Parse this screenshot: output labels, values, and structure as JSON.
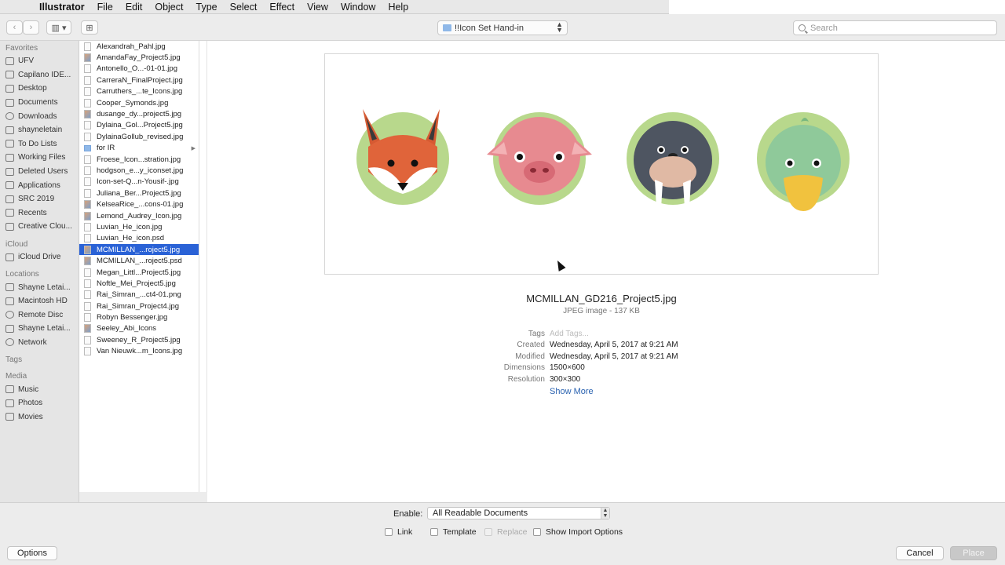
{
  "menubar": {
    "app": "Illustrator",
    "items": [
      "File",
      "Edit",
      "Object",
      "Type",
      "Select",
      "Effect",
      "View",
      "Window",
      "Help"
    ]
  },
  "toolbar": {
    "path": "!!Icon Set Hand-in",
    "search_placeholder": "Search"
  },
  "sidebar": {
    "favorites_title": "Favorites",
    "favorites": [
      "UFV",
      "Capilano IDE...",
      "Desktop",
      "Documents",
      "Downloads",
      "shayneletain",
      "To Do Lists",
      "Working Files",
      "Deleted Users",
      "Applications",
      "SRC 2019",
      "Recents",
      "Creative Clou..."
    ],
    "icloud_title": "iCloud",
    "icloud": [
      "iCloud Drive"
    ],
    "locations_title": "Locations",
    "locations": [
      "Shayne Letai...",
      "Macintosh HD",
      "Remote Disc",
      "Shayne Letai...",
      "Network"
    ],
    "tags_title": "Tags",
    "media_title": "Media",
    "media": [
      "Music",
      "Photos",
      "Movies"
    ]
  },
  "files": [
    {
      "name": "Alexandrah_Pahl.jpg",
      "kind": "doc"
    },
    {
      "name": "AmandaFay_Project5.jpg",
      "kind": "img"
    },
    {
      "name": "Antonello_O...-01-01.jpg",
      "kind": "doc"
    },
    {
      "name": "CarreraN_FinalProject.jpg",
      "kind": "doc"
    },
    {
      "name": "Carruthers_...te_Icons.jpg",
      "kind": "doc"
    },
    {
      "name": "Cooper_Symonds.jpg",
      "kind": "doc"
    },
    {
      "name": "dusange_dy...project5.jpg",
      "kind": "img"
    },
    {
      "name": "Dylaina_Gol...Project5.jpg",
      "kind": "doc"
    },
    {
      "name": "DylainaGollub_revised.jpg",
      "kind": "doc"
    },
    {
      "name": "for IR",
      "kind": "folder"
    },
    {
      "name": "Froese_Icon...stration.jpg",
      "kind": "doc"
    },
    {
      "name": "hodgson_e...y_iconset.jpg",
      "kind": "doc"
    },
    {
      "name": "Icon-set-Q...n-Yousif-.jpg",
      "kind": "doc"
    },
    {
      "name": "Juliana_Ber...Project5.jpg",
      "kind": "doc"
    },
    {
      "name": "KelseaRice_...cons-01.jpg",
      "kind": "img"
    },
    {
      "name": "Lemond_Audrey_Icon.jpg",
      "kind": "img"
    },
    {
      "name": "Luvian_He_icon.jpg",
      "kind": "doc"
    },
    {
      "name": "Luvian_He_icon.psd",
      "kind": "doc"
    },
    {
      "name": "MCMILLAN_...roject5.jpg",
      "kind": "img",
      "selected": true
    },
    {
      "name": "MCMILLAN_...roject5.psd",
      "kind": "img"
    },
    {
      "name": "Megan_Littl...Project5.jpg",
      "kind": "doc"
    },
    {
      "name": "Noftle_Mei_Project5.jpg",
      "kind": "doc"
    },
    {
      "name": "Rai_Simran_...ct4-01.png",
      "kind": "doc"
    },
    {
      "name": "Rai_Simran_Project4.jpg",
      "kind": "doc"
    },
    {
      "name": "Robyn Bessenger.jpg",
      "kind": "doc"
    },
    {
      "name": "Seeley_Abi_Icons",
      "kind": "img"
    },
    {
      "name": "Sweeney_R_Project5.jpg",
      "kind": "doc"
    },
    {
      "name": "Van Nieuwk...m_Icons.jpg",
      "kind": "doc"
    }
  ],
  "preview": {
    "filename": "MCMILLAN_GD216_Project5.jpg",
    "kind": "JPEG image - 137 KB",
    "tags_label": "Tags",
    "tags_value": "Add Tags...",
    "created_label": "Created",
    "created_value": "Wednesday, April 5, 2017 at 9:21 AM",
    "modified_label": "Modified",
    "modified_value": "Wednesday, April 5, 2017 at 9:21 AM",
    "dimensions_label": "Dimensions",
    "dimensions_value": "1500×600",
    "resolution_label": "Resolution",
    "resolution_value": "300×300",
    "show_more": "Show More"
  },
  "bottom": {
    "enable_label": "Enable:",
    "enable_value": "All Readable Documents",
    "link": "Link",
    "template": "Template",
    "replace": "Replace",
    "show_import": "Show Import Options",
    "options": "Options",
    "cancel": "Cancel",
    "place": "Place"
  }
}
